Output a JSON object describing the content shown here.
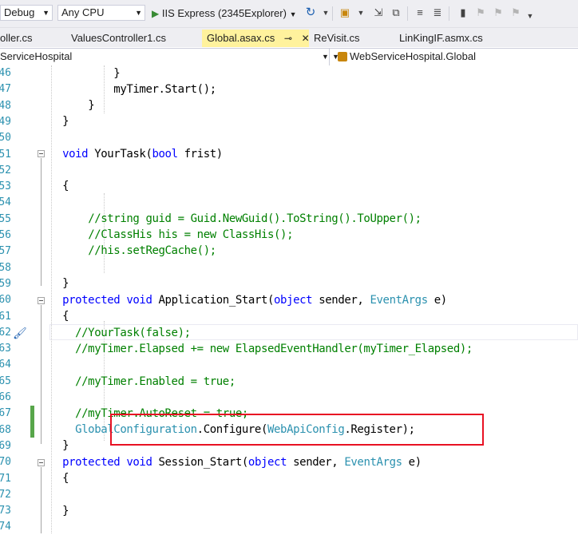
{
  "toolbar": {
    "config_combo": "Debug",
    "platform_combo": "Any CPU",
    "run_label": "IIS Express (2345Explorer)",
    "icons": [
      "play-icon",
      "dropdown-arrow-icon",
      "refresh-icon",
      "solution-explorer-icon",
      "step-icon",
      "comment-icon",
      "uncomment-icon",
      "bookmark-icon"
    ]
  },
  "tabs": [
    {
      "label": "oller.cs",
      "active": false
    },
    {
      "label": "ValuesController1.cs",
      "active": false
    },
    {
      "label": "Global.asax.cs",
      "active": true,
      "pin": "⊸",
      "close": "✕"
    },
    {
      "label": "ReVisit.cs",
      "active": false
    },
    {
      "label": "LinKingIF.asmx.cs",
      "active": false
    }
  ],
  "navbar": {
    "project": "ServiceHospital",
    "class_name": "WebServiceHospital.Global"
  },
  "editor": {
    "line_numbers": [
      "46",
      "47",
      "48",
      "49",
      "50",
      "51",
      "52",
      "53",
      "54",
      "55",
      "56",
      "57",
      "58",
      "59",
      "60",
      "61",
      "62",
      "63",
      "64",
      "65",
      "66",
      "67",
      "68",
      "69",
      "70",
      "71",
      "72",
      "73",
      "74"
    ],
    "lines": {
      "l46_brace": "}",
      "l47_code": "myTimer.Start();",
      "l48_brace": "}",
      "l49_brace": "}",
      "l51_kw": "void",
      "l51_name": " YourTask(",
      "l51_kw2": "bool",
      "l51_rest": " frist)",
      "l53_brace": "{",
      "l55_comment": "//string guid = Guid.NewGuid().ToString().ToUpper();",
      "l56_comment": "//ClassHis his = new ClassHis();",
      "l57_comment": "//his.setRegCache();",
      "l59_brace": "}",
      "l60_kw1": "protected",
      "l60_kw2": "void",
      "l60_name": " Application_Start(",
      "l60_kw3": "object",
      "l60_mid": " sender, ",
      "l60_type": "EventArgs",
      "l60_end": " e)",
      "l61_brace": "{",
      "l62_comment": "//YourTask(false);",
      "l63_comment": "//myTimer.Elapsed += new ElapsedEventHandler(myTimer_Elapsed);",
      "l65_comment": "//myTimer.Enabled = true;",
      "l67_comment": "//myTimer.AutoReset = true;",
      "l68_type1": "GlobalConfiguration",
      "l68_mid": ".Configure(",
      "l68_type2": "WebApiConfig",
      "l68_end": ".Register);",
      "l69_brace": "}",
      "l70_kw1": "protected",
      "l70_kw2": "void",
      "l70_name": " Session_Start(",
      "l70_kw3": "object",
      "l70_mid": " sender, ",
      "l70_type": "EventArgs",
      "l70_end": " e)",
      "l71_brace": "{",
      "l73_brace": "}"
    }
  },
  "colors": {
    "keyword": "#0000ff",
    "type": "#2b91af",
    "comment": "#008000",
    "highlight_box": "#e81123",
    "active_tab": "#fff29d",
    "change_bar": "#57a64a"
  }
}
